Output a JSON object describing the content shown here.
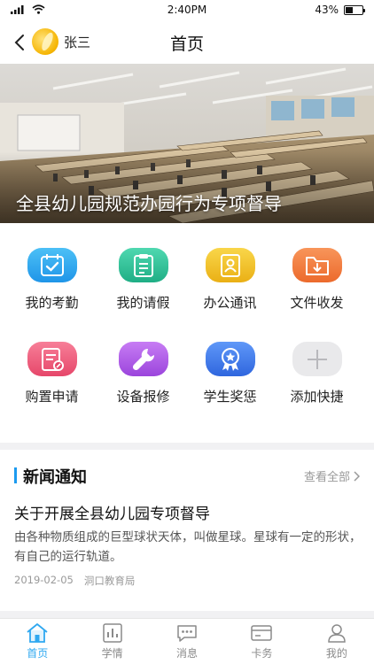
{
  "status_bar": {
    "time": "2:40PM",
    "battery": "43%",
    "battery_level": 0.43
  },
  "nav": {
    "user_name": "张三",
    "title": "首页"
  },
  "banner": {
    "caption": "全县幼儿园规范办园行为专项督导"
  },
  "quick_actions": [
    {
      "label": "我的考勤",
      "icon": "attendance-check-icon",
      "color": "#2fa8f0"
    },
    {
      "label": "我的请假",
      "icon": "leave-clipboard-icon",
      "color": "#2ec29a"
    },
    {
      "label": "办公通讯",
      "icon": "contacts-book-icon",
      "color": "#f3c12a"
    },
    {
      "label": "文件收发",
      "icon": "file-folder-icon",
      "color": "#f0783a"
    },
    {
      "label": "购置申请",
      "icon": "purchase-form-icon",
      "color": "#ef5a78"
    },
    {
      "label": "设备报修",
      "icon": "wrench-icon",
      "color": "#b15ae8"
    },
    {
      "label": "学生奖惩",
      "icon": "medal-star-icon",
      "color": "#3f7cf0"
    },
    {
      "label": "添加快捷",
      "icon": "plus-icon",
      "color": "#e4e4e6"
    }
  ],
  "news": {
    "section_title": "新闻通知",
    "view_all": "查看全部",
    "article": {
      "title": "关于开展全县幼儿园专项督导",
      "desc": "由各种物质组成的巨型球状天体，叫做星球。星球有一定的形状，有自己的运行轨道。",
      "date": "2019-02-05",
      "source": "洞口教育局"
    }
  },
  "tabs": [
    {
      "label": "首页",
      "icon": "home-icon",
      "active": true
    },
    {
      "label": "学情",
      "icon": "chart-icon",
      "active": false
    },
    {
      "label": "消息",
      "icon": "message-icon",
      "active": false
    },
    {
      "label": "卡务",
      "icon": "card-icon",
      "active": false
    },
    {
      "label": "我的",
      "icon": "profile-icon",
      "active": false
    }
  ],
  "colors": {
    "accent": "#1c9bf0",
    "tab_active": "#2fa8f0",
    "tab_inactive": "#8a8a8a"
  }
}
